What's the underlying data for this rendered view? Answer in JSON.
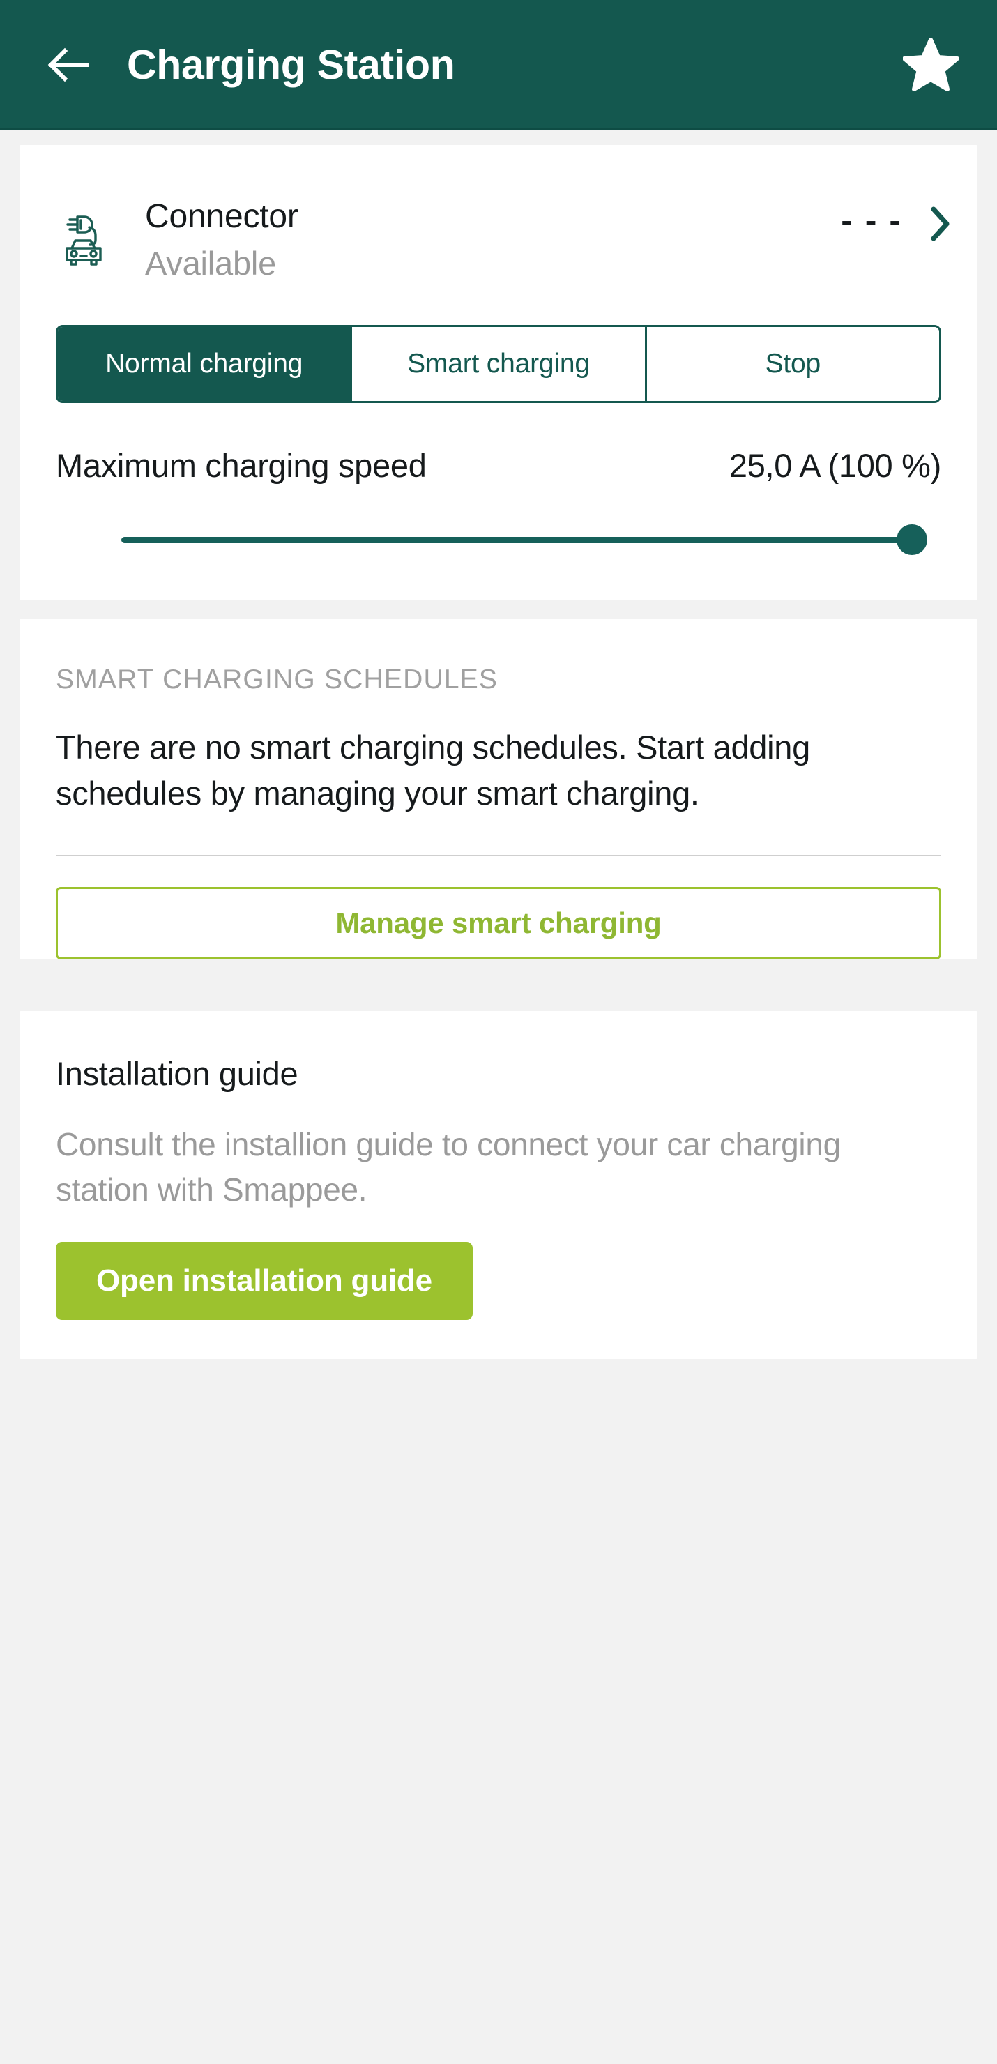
{
  "header": {
    "title": "Charging Station",
    "back_icon": "arrow-left-icon",
    "favorite_icon": "star-filled-icon"
  },
  "connector": {
    "icon": "ev-car-plug-icon",
    "name": "Connector",
    "status": "Available",
    "value": "- - -",
    "chevron_icon": "chevron-right-icon"
  },
  "mode_selector": {
    "options": [
      {
        "label": "Normal charging",
        "active": true
      },
      {
        "label": "Smart charging",
        "active": false
      },
      {
        "label": "Stop",
        "active": false
      }
    ]
  },
  "max_speed": {
    "label": "Maximum charging speed",
    "value": "25,0 A (100 %)",
    "slider_percent": 100
  },
  "schedules": {
    "section_title": "SMART CHARGING SCHEDULES",
    "empty_text": "There are no smart charging schedules. Start adding schedules by managing your smart charging.",
    "manage_button": "Manage smart charging"
  },
  "installation": {
    "title": "Installation guide",
    "description": "Consult the installion guide to connect your car charging station with Smappee.",
    "open_button": "Open installation guide"
  },
  "colors": {
    "header_teal": "#14584f",
    "accent_green": "#9cc22e",
    "slider_teal": "#16605a",
    "page_background": "#f2f2f2"
  }
}
